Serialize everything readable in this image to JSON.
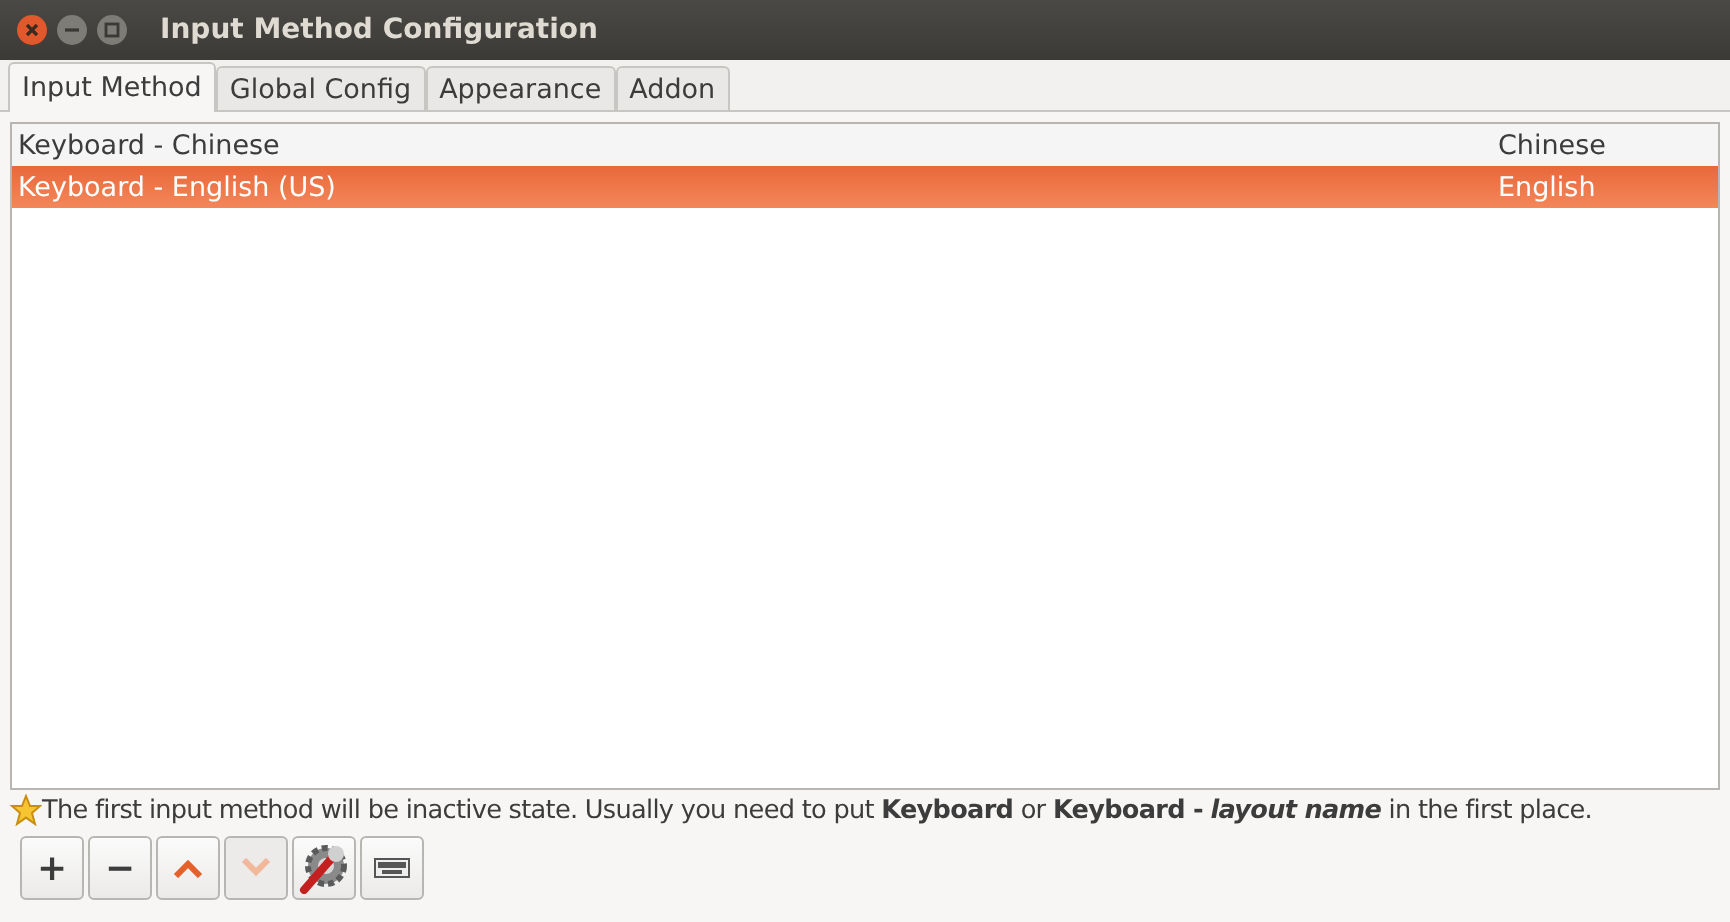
{
  "window": {
    "title": "Input Method Configuration"
  },
  "tabs": [
    {
      "label": "Input Method",
      "selected": true
    },
    {
      "label": "Global Config",
      "selected": false
    },
    {
      "label": "Appearance",
      "selected": false
    },
    {
      "label": "Addon",
      "selected": false
    }
  ],
  "input_methods": [
    {
      "name": "Keyboard - Chinese",
      "language": "Chinese",
      "selected": false
    },
    {
      "name": "Keyboard - English (US)",
      "language": "English",
      "selected": true
    }
  ],
  "hint": "The first input method will be inactive state. Usually you need to put **Keyboard** or **Keyboard -** *layout name* in the first place.",
  "toolbar": [
    {
      "kind": "text",
      "label": "+",
      "disabled": false
    },
    {
      "kind": "text",
      "label": "−",
      "disabled": false
    },
    {
      "kind": "up",
      "disabled": false
    },
    {
      "kind": "down",
      "disabled": true
    },
    {
      "kind": "configure",
      "disabled": false
    },
    {
      "kind": "keyboard",
      "disabled": false
    }
  ]
}
